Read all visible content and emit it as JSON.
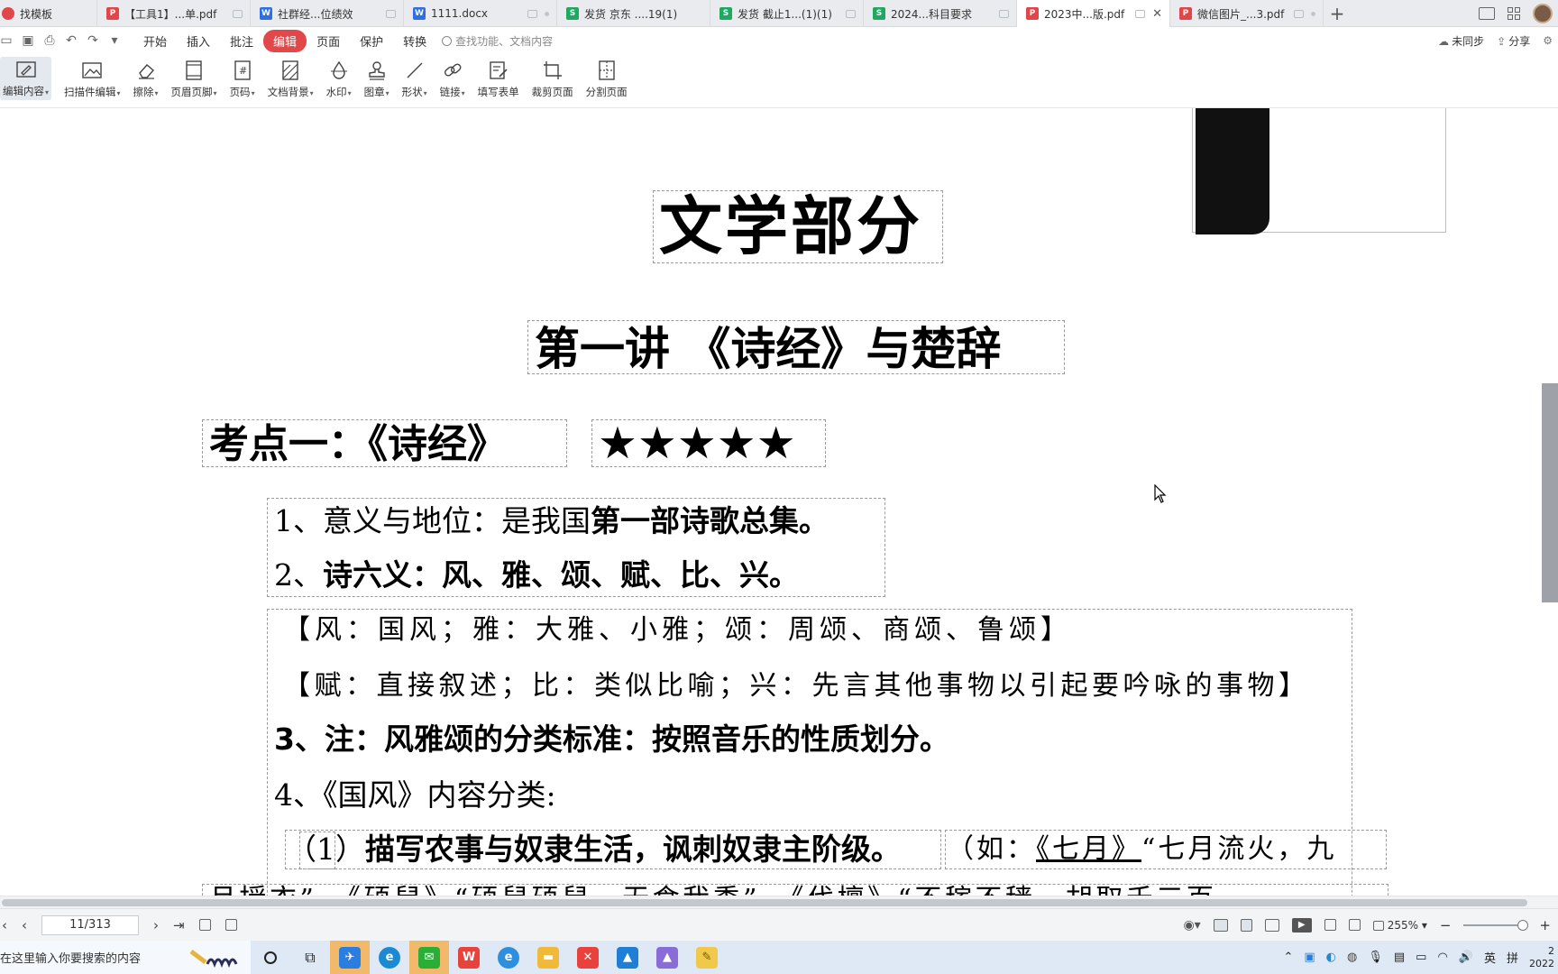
{
  "tabs": [
    {
      "label": "找模板",
      "icon": "template-icon",
      "kind": "tpl"
    },
    {
      "label": "【工具1】...单.pdf",
      "icon": "pdf-icon",
      "kind": "pdf"
    },
    {
      "label": "社群经...位绩效",
      "icon": "doc-icon",
      "kind": "doc"
    },
    {
      "label": "1111.docx",
      "icon": "doc-icon",
      "kind": "doc"
    },
    {
      "label": "发货 京东 ....19(1)",
      "icon": "sheet-icon",
      "kind": "xls"
    },
    {
      "label": "发货 截止1...(1)(1)",
      "icon": "sheet-icon",
      "kind": "xls"
    },
    {
      "label": "2024...科目要求",
      "icon": "sheet-icon",
      "kind": "xls"
    },
    {
      "label": "2023中...版.pdf",
      "icon": "pdf-icon",
      "kind": "pdf",
      "active": true
    },
    {
      "label": "微信图片_...3.pdf",
      "icon": "pdf-icon",
      "kind": "pdf"
    }
  ],
  "menu": {
    "items": [
      "开始",
      "插入",
      "批注",
      "编辑",
      "页面",
      "保护",
      "转换"
    ],
    "active": "编辑",
    "search_placeholder": "查找功能、文档内容",
    "sync_label": "未同步",
    "share_label": "分享"
  },
  "toolbar": {
    "tools": [
      {
        "label": "编辑内容",
        "icon": "edit-content-icon",
        "caret": true,
        "selected": true
      },
      {
        "label": "扫描件编辑",
        "icon": "scan-edit-icon",
        "caret": true
      },
      {
        "label": "擦除",
        "icon": "eraser-icon",
        "caret": true
      },
      {
        "label": "页眉页脚",
        "icon": "header-footer-icon",
        "caret": true
      },
      {
        "label": "页码",
        "icon": "page-number-icon",
        "caret": true
      },
      {
        "label": "文档背景",
        "icon": "background-icon",
        "caret": true
      },
      {
        "label": "水印",
        "icon": "watermark-icon",
        "caret": true
      },
      {
        "label": "图章",
        "icon": "stamp-icon",
        "caret": true
      },
      {
        "label": "形状",
        "icon": "shape-icon",
        "caret": true
      },
      {
        "label": "链接",
        "icon": "link-icon",
        "caret": true
      },
      {
        "label": "填写表单",
        "icon": "form-icon",
        "caret": false
      },
      {
        "label": "裁剪页面",
        "icon": "crop-icon",
        "caret": false
      },
      {
        "label": "分割页面",
        "icon": "split-icon",
        "caret": false
      }
    ]
  },
  "document": {
    "title": "文学部分",
    "lecture": "第一讲 《诗经》与楚辞",
    "topic": "考点一：《诗经》",
    "stars": "★★★★★",
    "p1_normal": "1、意义与地位：是我国",
    "p1_bold": "第一部诗歌总集。",
    "p2_num": "2、",
    "p2_bold": "诗六义：风、雅、颂、赋、比、兴。",
    "bracket1": "【风：国风；雅：大雅、小雅；颂：周颂、商颂、鲁颂】",
    "bracket2": "【赋：直接叙述；比：类似比喻；兴：先言其他事物以引起要吟咏的事物】",
    "p3": "3、注：风雅颂的分类标准：按照音乐的性质划分。",
    "p4": "4、《国风》内容分类:",
    "p5_open": "（",
    "p5_num": "1）",
    "p5_bold": "描写农事与奴隶生活，讽刺奴隶主阶级。",
    "p5_eg_prefix": "（如：",
    "p5_eg_title": "《七月》",
    "p5_eg_quote": "“七月流火，九",
    "p6_cut": "月授衣”、《硕鼠》“硕鼠硕鼠，无食我黍”、《伐檀》“不稼不穑，胡取禾三百"
  },
  "statusbar": {
    "page": "11/313",
    "zoom": "255%"
  },
  "taskbar": {
    "search_placeholder": "在这里输入你要搜索的内容",
    "lang": "英",
    "ime": "拼",
    "clock_line1": "2",
    "clock_line2": "2022"
  }
}
